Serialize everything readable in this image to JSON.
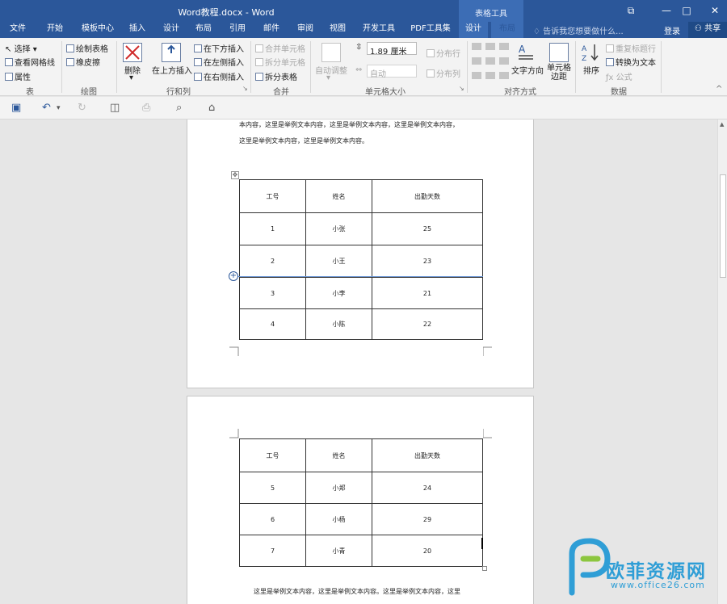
{
  "window": {
    "title": "Word教程.docx - Word",
    "context_header": "表格工具"
  },
  "tabs": [
    "文件",
    "开始",
    "模板中心",
    "插入",
    "设计",
    "布局",
    "引用",
    "邮件",
    "审阅",
    "视图",
    "开发工具",
    "PDF工具集",
    "设计",
    "布局"
  ],
  "active_tab_index": 13,
  "tell_me": "告诉我您想要做什么...",
  "login": "登录",
  "share": "共享",
  "ribbon": {
    "table": {
      "select": "选择",
      "gridlines": "查看网格线",
      "properties": "属性",
      "group": "表"
    },
    "draw": {
      "draw_table": "绘制表格",
      "eraser": "橡皮擦",
      "group": "绘图"
    },
    "rows_cols": {
      "delete": "删除",
      "insert_above": "在上方插入",
      "insert_below": "在下方插入",
      "insert_left": "在左侧插入",
      "insert_right": "在右侧插入",
      "group": "行和列"
    },
    "merge": {
      "merge_cells": "合并单元格",
      "split_cells": "拆分单元格",
      "split_table": "拆分表格",
      "group": "合并"
    },
    "cell_size": {
      "autofit": "自动调整",
      "height": "1.89 厘米",
      "width": "自动",
      "dist_rows": "分布行",
      "dist_cols": "分布列",
      "group": "单元格大小"
    },
    "alignment": {
      "text_direction": "文字方向",
      "cell_margins": "单元格边距",
      "group": "对齐方式"
    },
    "data": {
      "sort": "排序",
      "repeat_header": "重复标题行",
      "to_text": "转换为文本",
      "formula": "公式",
      "group": "数据"
    }
  },
  "document": {
    "p1_line1": "本内容，这里是举例文本内容，这里是举例文本内容，这里是举例文本内容，",
    "p1_line2": "这里是举例文本内容，这里是举例文本内容。",
    "p2_line1": "这里是举例文本内容，这里是举例文本内容。这里是举例文本内容，这里",
    "table_headers": [
      "工号",
      "姓名",
      "出勤天数"
    ],
    "table1_rows": [
      [
        "1",
        "小张",
        "25"
      ],
      [
        "2",
        "小王",
        "23"
      ],
      [
        "3",
        "小李",
        "21"
      ],
      [
        "4",
        "小陈",
        "22"
      ]
    ],
    "table2_rows": [
      [
        "5",
        "小郑",
        "24"
      ],
      [
        "6",
        "小杨",
        "29"
      ],
      [
        "7",
        "小青",
        "20"
      ]
    ]
  },
  "watermark": {
    "text": "欧菲资源网",
    "url": "www.office26.com"
  },
  "colors": {
    "title_bar": "#2b579a",
    "ribbon_bg": "#f3f3f3",
    "context_tab": "#3c6db5"
  }
}
